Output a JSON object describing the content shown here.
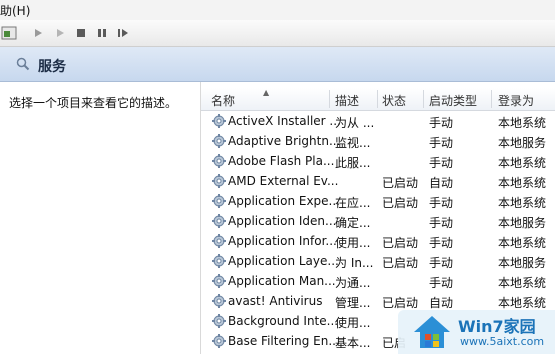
{
  "menubar": {
    "label": "助(H)"
  },
  "toolbar": {
    "buttons": [
      "console-icon",
      "play-icon",
      "play-outline-icon",
      "stop-icon",
      "pause-icon",
      "restart-icon"
    ]
  },
  "header": {
    "title": "服务"
  },
  "left_pane": {
    "description_prompt": "选择一个项目来查看它的描述。"
  },
  "table": {
    "columns": {
      "name": "名称",
      "desc": "描述",
      "status": "状态",
      "startup": "启动类型",
      "login": "登录为"
    },
    "rows": [
      {
        "name": "ActiveX Installer ...",
        "desc": "为从 ...",
        "status": "",
        "startup": "手动",
        "login": "本地系统"
      },
      {
        "name": "Adaptive Brightn...",
        "desc": "监视...",
        "status": "",
        "startup": "手动",
        "login": "本地服务"
      },
      {
        "name": "Adobe Flash Pla...",
        "desc": "此服...",
        "status": "",
        "startup": "手动",
        "login": "本地系统"
      },
      {
        "name": "AMD External Ev...",
        "desc": "",
        "status": "已启动",
        "startup": "自动",
        "login": "本地系统"
      },
      {
        "name": "Application Expe...",
        "desc": "在应...",
        "status": "已启动",
        "startup": "手动",
        "login": "本地系统"
      },
      {
        "name": "Application Iden...",
        "desc": "确定...",
        "status": "",
        "startup": "手动",
        "login": "本地服务"
      },
      {
        "name": "Application Infor...",
        "desc": "使用...",
        "status": "已启动",
        "startup": "手动",
        "login": "本地系统"
      },
      {
        "name": "Application Laye...",
        "desc": "为 In...",
        "status": "已启动",
        "startup": "手动",
        "login": "本地服务"
      },
      {
        "name": "Application Man...",
        "desc": "为通...",
        "status": "",
        "startup": "手动",
        "login": "本地系统"
      },
      {
        "name": "avast! Antivirus",
        "desc": "管理...",
        "status": "已启动",
        "startup": "自动",
        "login": "本地系统"
      },
      {
        "name": "Background Inte...",
        "desc": "使用...",
        "status": "",
        "startup": "",
        "login": ""
      },
      {
        "name": "Base Filtering En...",
        "desc": "基本...",
        "status": "已启",
        "startup": "",
        "login": ""
      }
    ]
  },
  "watermark": {
    "title": "Win7家园",
    "url": "www.5aixt.com"
  }
}
